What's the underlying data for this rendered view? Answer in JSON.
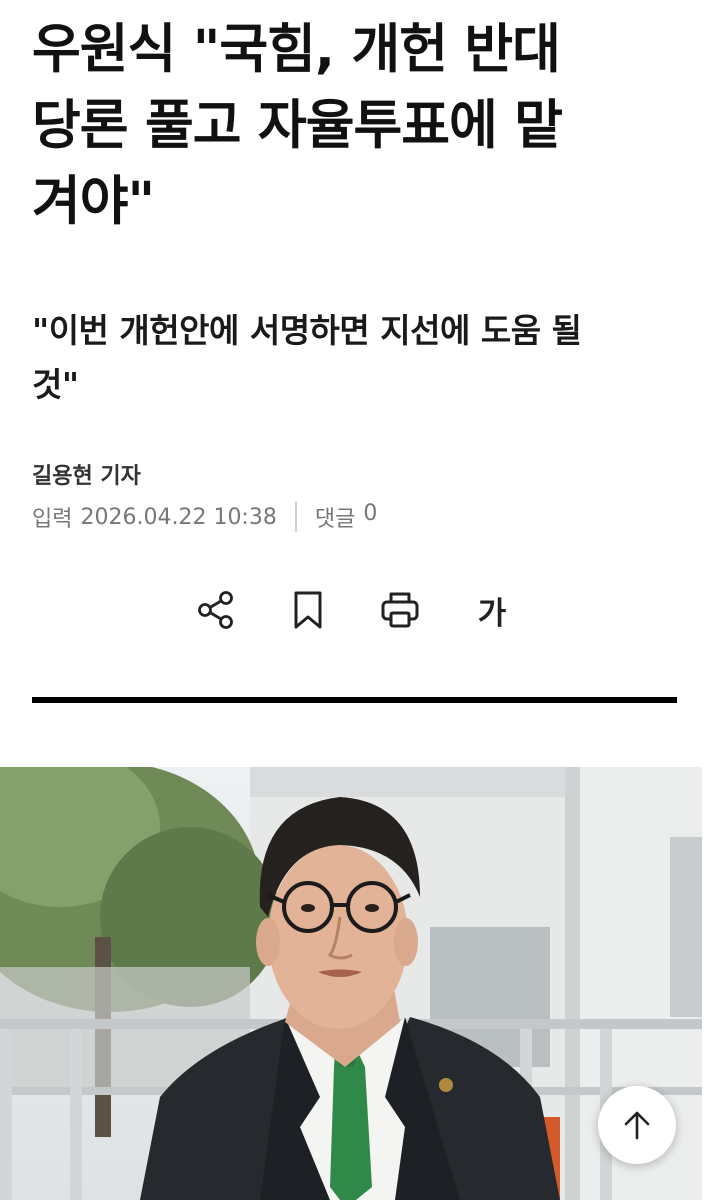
{
  "article": {
    "headline_lines": [
      "우원식 \"국힘, 개헌 반대",
      "당론 풀고 자율투표에 맡",
      "겨야\""
    ],
    "subheadline_lines": [
      "\"이번 개헌안에 서명하면 지선에 도움 될",
      "것\""
    ],
    "author": "길용현 기자",
    "published_label": "입력",
    "published_datetime": "2026.04.22 10:38",
    "comments_label": "댓글",
    "comments_count": "0"
  },
  "toolbar": {
    "share_icon": "share-icon",
    "bookmark_icon": "bookmark-icon",
    "print_icon": "printer-icon",
    "font_size_label": "가"
  },
  "photo": {
    "description_icon": "article-photo"
  },
  "scroll_top_icon": "arrow-up-icon"
}
